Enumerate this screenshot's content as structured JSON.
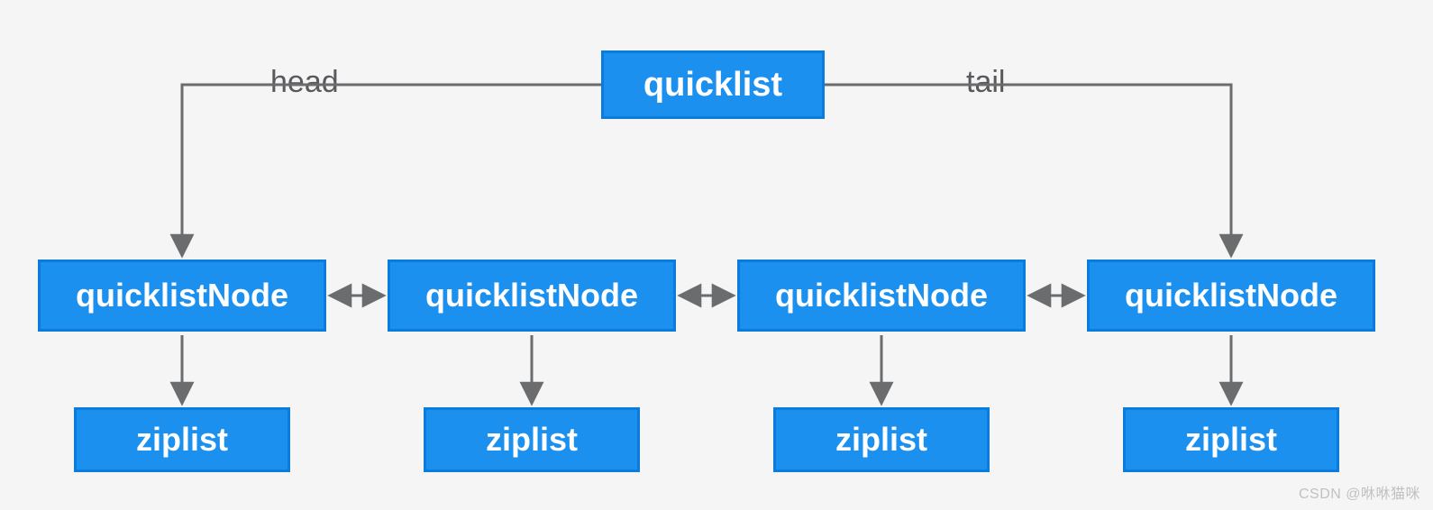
{
  "root": {
    "label": "quicklist"
  },
  "pointers": {
    "head": "head",
    "tail": "tail"
  },
  "nodes": [
    {
      "label": "quicklistNode",
      "zip": "ziplist"
    },
    {
      "label": "quicklistNode",
      "zip": "ziplist"
    },
    {
      "label": "quicklistNode",
      "zip": "ziplist"
    },
    {
      "label": "quicklistNode",
      "zip": "ziplist"
    }
  ],
  "watermark": "CSDN @咻咻猫咪",
  "colors": {
    "box_fill": "#1b90ef",
    "box_border": "#0b7bdc",
    "arrow": "#6b6c6e",
    "bg": "#f5f5f5"
  }
}
